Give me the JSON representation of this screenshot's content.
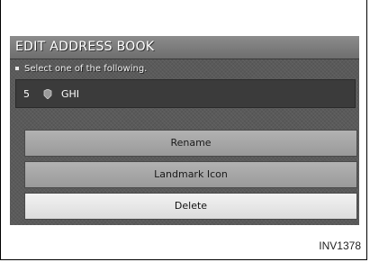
{
  "screen": {
    "title": "EDIT ADDRESS BOOK",
    "instruction": "Select one of the following.",
    "entry": {
      "number": "5",
      "name": "GHI",
      "icon": "landmark-icon"
    }
  },
  "menu": {
    "items": [
      {
        "label": "Rename",
        "selected": false
      },
      {
        "label": "Landmark Icon",
        "selected": false
      },
      {
        "label": "Delete",
        "selected": true
      }
    ]
  },
  "figure": {
    "code": "INV1378"
  }
}
